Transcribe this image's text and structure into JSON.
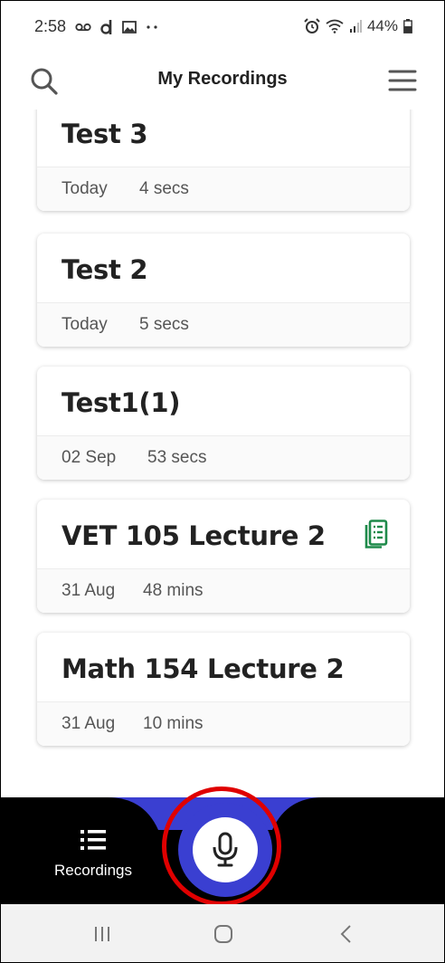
{
  "status_bar": {
    "time": "2:58",
    "battery": "44%",
    "icons": [
      "voicemail-icon",
      "d-app-icon",
      "gallery-icon",
      "more-dots-icon",
      "alarm-icon",
      "wifi-icon",
      "signal-icon",
      "battery-icon"
    ]
  },
  "header": {
    "title": "My Recordings",
    "left_icon": "search-icon",
    "right_icon": "hamburger-menu-icon"
  },
  "recordings": [
    {
      "name": "Test 3",
      "date": "Today",
      "duration": "4 secs",
      "has_transcript": false
    },
    {
      "name": "Test 2",
      "date": "Today",
      "duration": "5 secs",
      "has_transcript": false
    },
    {
      "name": "Test1(1)",
      "date": "02 Sep",
      "duration": "53 secs",
      "has_transcript": false
    },
    {
      "name": "VET 105 Lecture 2",
      "date": "31 Aug",
      "duration": "48 mins",
      "has_transcript": true
    },
    {
      "name": "Math 154 Lecture 2",
      "date": "31 Aug",
      "duration": "10 mins",
      "has_transcript": false
    }
  ],
  "bottom_nav": {
    "recordings_label": "Recordings",
    "recordings_icon": "list-icon",
    "record_icon": "microphone-icon"
  },
  "colors": {
    "accent": "#3a3fd1",
    "highlight_ring": "#e00000",
    "transcript_icon": "#1e8a4a"
  },
  "system_nav": [
    "recent-apps-icon",
    "home-icon",
    "back-icon"
  ]
}
